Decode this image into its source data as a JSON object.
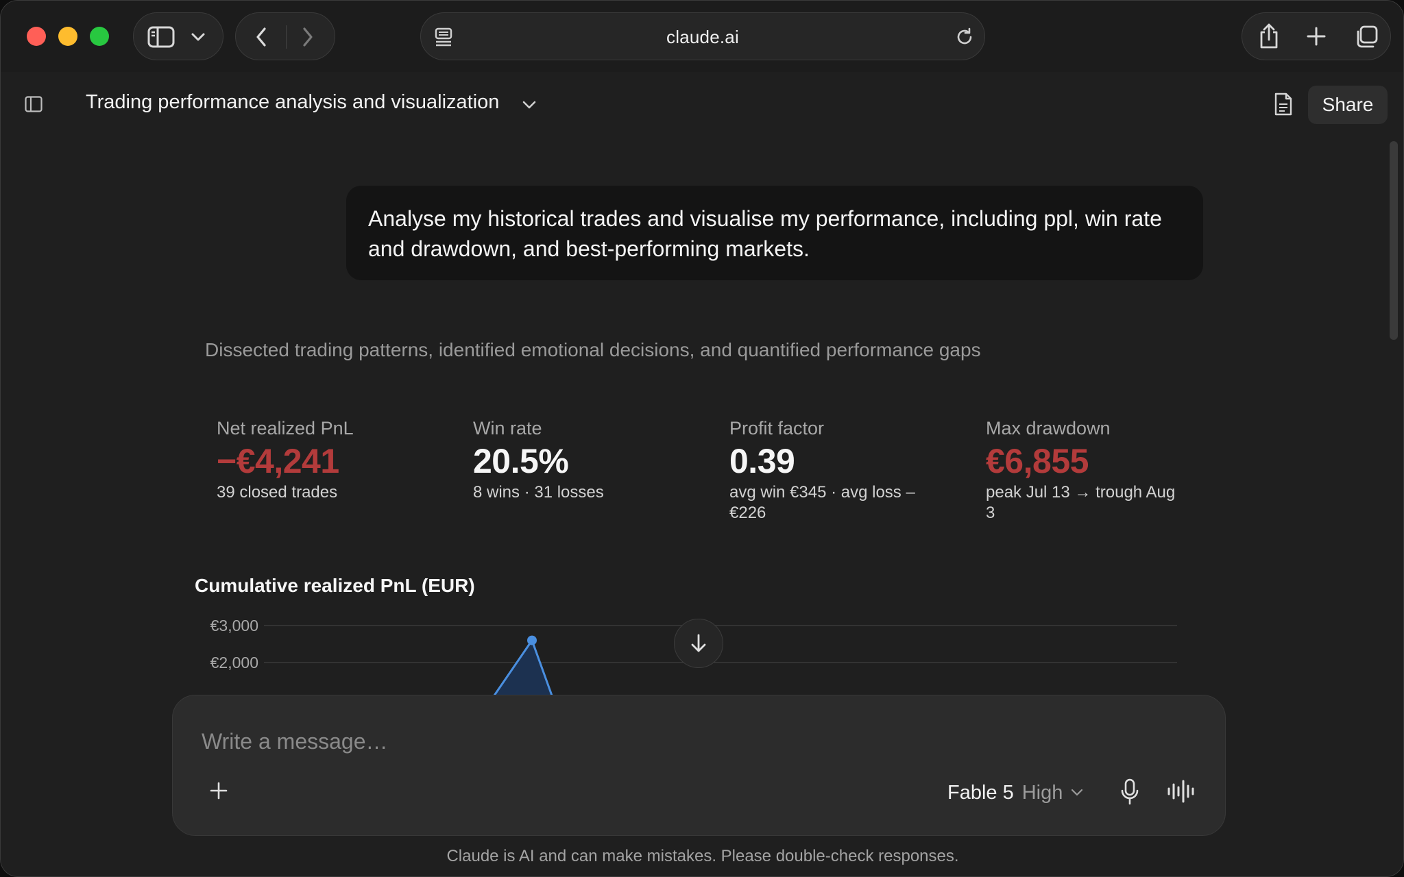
{
  "browser": {
    "url": "claude.ai",
    "icons": {
      "sidebar": "sidebar-toggle-icon",
      "dropdown": "chevron-down-icon",
      "back": "chevron-left-icon",
      "forward": "chevron-right-icon",
      "page_menu": "page-menu-icon",
      "reload": "reload-icon",
      "share": "share-icon",
      "new_tab": "plus-icon",
      "tabs": "tab-overview-icon"
    },
    "traffic_colors": [
      "#ff5f57",
      "#febc2e",
      "#28c840"
    ]
  },
  "header": {
    "title": "Trading performance analysis and visualization",
    "share_label": "Share"
  },
  "conversation": {
    "user_message": "Analyse my historical trades and visualise my performance, including ppl, win rate and drawdown, and best-performing markets.",
    "thinking_summary": "Dissected trading patterns, identified emotional decisions, and quantified performance gaps",
    "metrics": [
      {
        "label": "Net realized PnL",
        "value": "−€4,241",
        "sub": "39 closed trades",
        "tone": "negative"
      },
      {
        "label": "Win rate",
        "value": "20.5%",
        "sub": "8 wins · 31 losses",
        "tone": "neutral"
      },
      {
        "label": "Profit factor",
        "value": "0.39",
        "sub": "avg win €345 · avg loss –€226",
        "tone": "neutral"
      },
      {
        "label": "Max drawdown",
        "value": "€6,855",
        "sub": "peak Jul 13 → trough Aug 3",
        "tone": "negative"
      }
    ]
  },
  "chart_data": {
    "type": "area",
    "title": "Cumulative realized PnL (EUR)",
    "ytick_labels": [
      "€3,000",
      "€2,000"
    ],
    "yticks": [
      3000,
      2000
    ],
    "peak": {
      "label": "Jul 13",
      "value": 2600
    },
    "color": "#4a8fe0",
    "grid": true
  },
  "composer": {
    "placeholder": "Write a message…",
    "model_name": "Fable 5",
    "effort": "High"
  },
  "disclaimer": "Claude is AI and can make mistakes. Please double-check responses.",
  "colors": {
    "negative": "#b33b3b",
    "accent": "#4a8fe0",
    "background": "#1f1f1f"
  }
}
